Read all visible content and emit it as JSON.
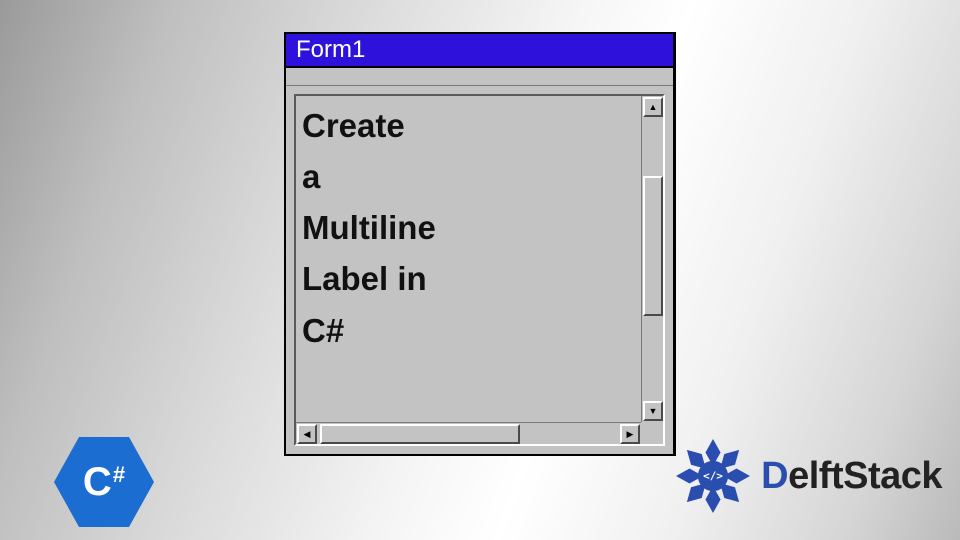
{
  "window": {
    "title": "Form1"
  },
  "label": {
    "lines": [
      "Create",
      "a",
      "Multiline",
      "Label in",
      "C#"
    ]
  },
  "badges": {
    "csharp": "C#",
    "brand": "DelftStack"
  },
  "scroll": {
    "up_glyph": "▲",
    "down_glyph": "▼",
    "left_glyph": "◀",
    "right_glyph": "▶"
  }
}
